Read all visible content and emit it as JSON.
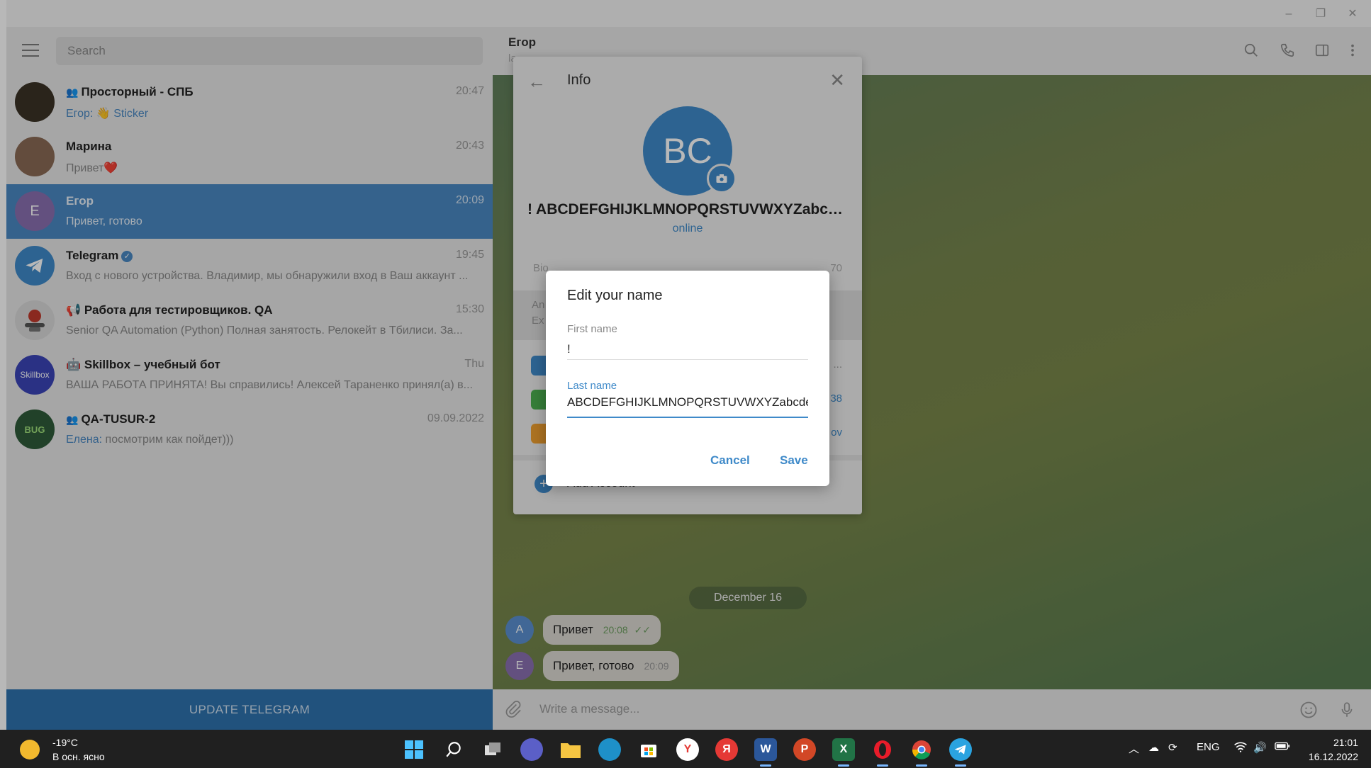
{
  "window": {
    "minimize": "–",
    "restore": "❐",
    "close": "✕"
  },
  "sidebar": {
    "search_placeholder": "Search",
    "chats": [
      {
        "initial": "",
        "name": "Просторный - СПБ",
        "time": "20:47",
        "sender": "Егор:",
        "preview": "👋 Sticker",
        "group": true,
        "avatar_color": "#3b3226"
      },
      {
        "initial": "",
        "name": "Марина",
        "time": "20:43",
        "sender": "",
        "preview": "Привет❤️",
        "group": false,
        "avatar_color": "#8a6a55"
      },
      {
        "initial": "Е",
        "name": "Егор",
        "time": "20:09",
        "sender": "",
        "preview": "Привет, готово",
        "group": false,
        "avatar_color": "#8a6fb0"
      },
      {
        "initial": "",
        "name": "Telegram",
        "time": "19:45",
        "sender": "",
        "preview": "Вход с нового устройства. Владимир, мы обнаружили вход в Ваш аккаунт ...",
        "group": false,
        "avatar_color": "#3f8ac9"
      },
      {
        "initial": "",
        "name": "📢 Работа для тестировщиков. QA",
        "time": "15:30",
        "sender": "",
        "preview": "Senior QA Automation (Python)  Полная занятость. Релокейт в Тбилиси. За...",
        "group": false,
        "avatar_color": "#d8d8d8"
      },
      {
        "initial": "Skillbox",
        "name": "🤖 Skillbox – учебный бот",
        "time": "Thu",
        "sender": "",
        "preview": "ВАША РАБОТА ПРИНЯТА!  Вы справились! Алексей Тараненко принял(а) в...",
        "group": false,
        "avatar_color": "#3b45b8"
      },
      {
        "initial": "BUG",
        "name": "QA-TUSUR-2",
        "time": "09.09.2022",
        "sender": "Елена:",
        "preview": "посмотрим как пойдет)))",
        "group": true,
        "avatar_color": "#2e5a3a"
      }
    ],
    "update_label": "UPDATE TELEGRAM"
  },
  "chat": {
    "title": "Егор",
    "subtitle": "la",
    "date_pill": "December 16",
    "messages": [
      {
        "avatar": "А",
        "avatar_color": "#5a8fd0",
        "text": "Привет",
        "time": "20:08",
        "ticks": "✓✓"
      },
      {
        "avatar": "Е",
        "avatar_color": "#8a6fb0",
        "text": "Привет, готово",
        "time": "20:09"
      }
    ],
    "composer_placeholder": "Write a message..."
  },
  "info": {
    "title": "Info",
    "avatar_initials": "BC",
    "full_name": "! ABCDEFGHIJKLMNOPQRSTUVWXYZabcde...",
    "status": "online",
    "bio_label": "Bio",
    "bio_count": "70",
    "gray_line1": "An",
    "gray_line2": "Ex",
    "frag_phone": "38",
    "frag_user": "ov",
    "frag_dots": "...",
    "add_account": "Add Account"
  },
  "dialog": {
    "title": "Edit your name",
    "first_label": "First name",
    "first_value": "!",
    "last_label": "Last name",
    "last_value": "ABCDEFGHIJKLMNOPQRSTUVWXYZabcdefghijklmnopqrstuvwxyz",
    "cancel": "Cancel",
    "save": "Save"
  },
  "taskbar": {
    "temp": "-19°C",
    "condition": "В осн. ясно",
    "lang": "ENG",
    "time": "21:01",
    "date": "16.12.2022"
  },
  "colors": {
    "accent": "#3f8ac9",
    "active_chat": "#4a88c2",
    "update_bar": "#2f72ad"
  }
}
